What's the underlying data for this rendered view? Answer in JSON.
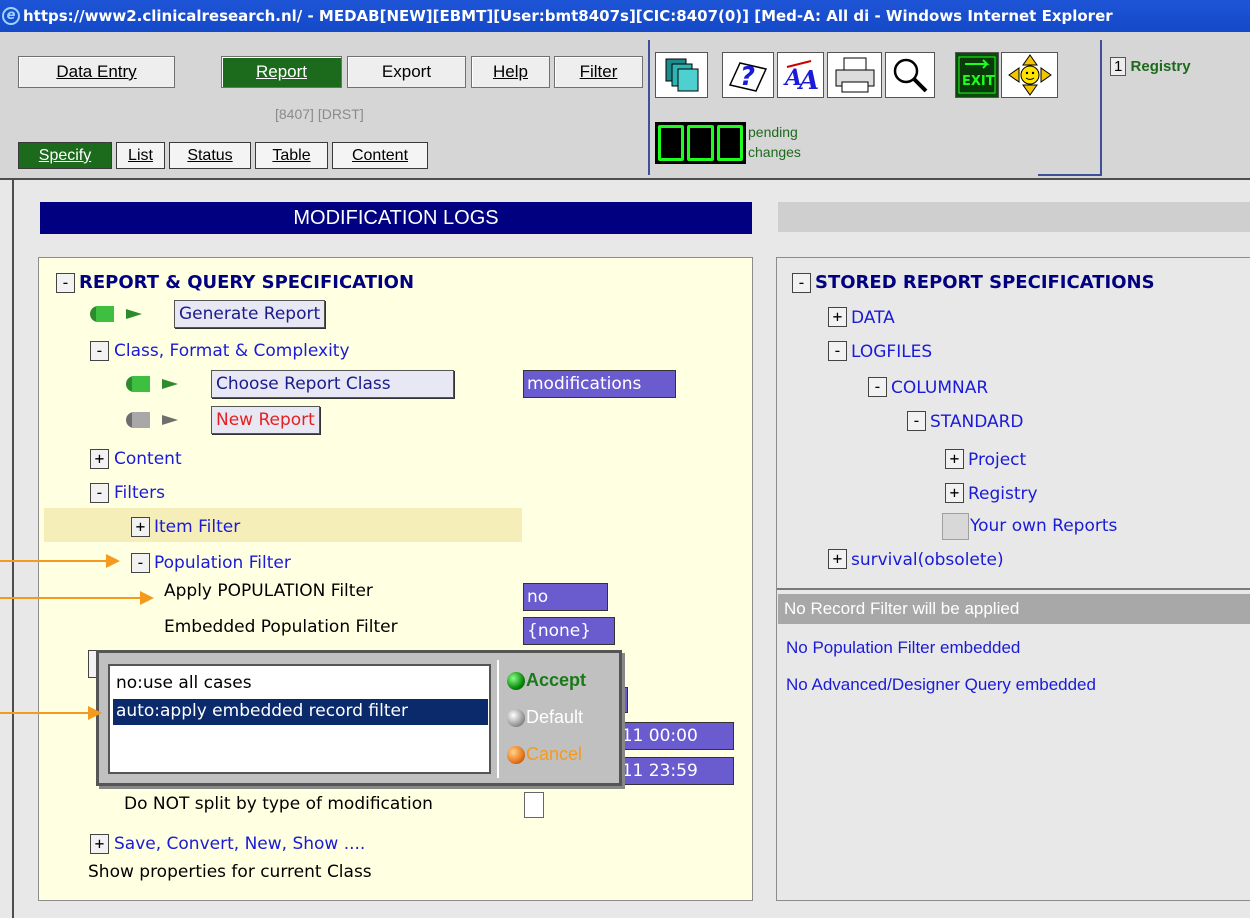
{
  "window": {
    "title": "https://www2.clinicalresearch.nl/ - MEDAB[NEW][EBMT][User:bmt8407s][CIC:8407(0)] [Med-A: All di - Windows Internet Explorer"
  },
  "menu": {
    "data_entry": "Data Entry",
    "report": "Report",
    "export": "Export",
    "help": "Help",
    "filter": "Filter"
  },
  "user_info": "[8407] [DRST]",
  "tabs": {
    "specify": "Specify",
    "list": "List",
    "status": "Status",
    "table": "Table",
    "content": "Content"
  },
  "pending": {
    "line1": "pending",
    "line2": "changes"
  },
  "registry_link": {
    "number": "1",
    "label": "Registry"
  },
  "toolbar_icons": [
    "copy-pages-icon",
    "help-icon",
    "font-size-icon",
    "print-icon",
    "search-icon",
    "exit-icon",
    "smiley-navigator-icon"
  ],
  "header": {
    "title": "MODIFICATION LOGS"
  },
  "left": {
    "spec_title": "REPORT & QUERY SPECIFICATION",
    "generate_report": "Generate Report",
    "class_format": "Class, Format & Complexity",
    "choose_report_class": "Choose Report Class",
    "report_class_value": "modifications",
    "new_report": "New Report",
    "content": "Content",
    "filters": "Filters",
    "item_filter": "Item Filter",
    "population_filter": "Population Filter",
    "apply_population_label": "Apply POPULATION Filter",
    "apply_population_value": "no",
    "embedded_population_label": "Embedded Population Filter",
    "embedded_population_value": "{none}",
    "date_from_tail": "/11 00:00",
    "date_to_tail": "/11 23:59",
    "no_split_label": "Do NOT split by type of modification",
    "save_convert": "Save, Convert, New, Show ....",
    "show_properties": "Show properties for current Class"
  },
  "popup": {
    "options": [
      "no:use all cases",
      "auto:apply embedded record filter"
    ],
    "selected_index": 1,
    "accept": "Accept",
    "default": "Default",
    "cancel": "Cancel"
  },
  "right": {
    "spec_title": "STORED REPORT SPECIFICATIONS",
    "data": "DATA",
    "logfiles": "LOGFILES",
    "columnar": "COLUMNAR",
    "standard": "STANDARD",
    "project": "Project",
    "registry": "Registry",
    "your_own_reports": "Your own Reports",
    "survival": "survival(obsolete)",
    "no_record_filter": "No Record Filter will be applied",
    "no_population_filter": "No Population Filter embedded",
    "no_advanced_query": "No Advanced/Designer Query embedded"
  },
  "tree_symbols": {
    "minus": "-",
    "plus": "+"
  },
  "colors": {
    "title_bar": "#1449c8",
    "active_green": "#1c6b1c",
    "header_navy": "#000080",
    "value_purple": "#6a5ccf",
    "link_blue": "#1a1ad9",
    "panel_yellow": "#ffffe1",
    "callout_orange": "#f39a1f"
  }
}
